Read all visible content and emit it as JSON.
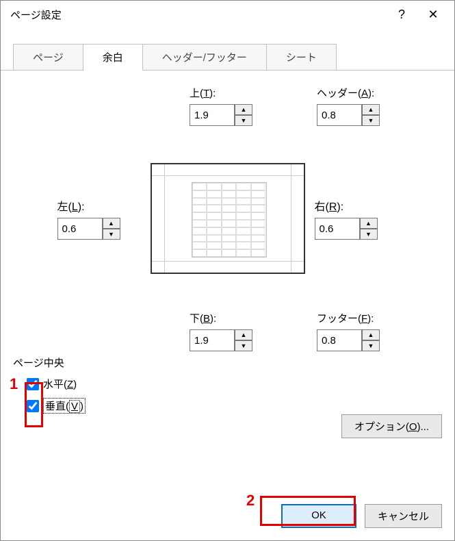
{
  "window": {
    "title": "ページ設定"
  },
  "tabs": {
    "page": "ページ",
    "margins": "余白",
    "header_footer": "ヘッダー/フッター",
    "sheet": "シート",
    "active": "margins"
  },
  "margins": {
    "top_label": "上(T):",
    "top_value": "1.9",
    "header_label": "ヘッダー(A):",
    "header_value": "0.8",
    "left_label": "左(L):",
    "left_value": "0.6",
    "right_label": "右(R):",
    "right_value": "0.6",
    "bottom_label": "下(B):",
    "bottom_value": "1.9",
    "footer_label": "フッター(F):",
    "footer_value": "0.8"
  },
  "center": {
    "legend": "ページ中央",
    "horizontal_label": "水平(Z)",
    "horizontal_checked": true,
    "vertical_label": "垂直(V)",
    "vertical_checked": true
  },
  "buttons": {
    "options": "オプション(O)...",
    "ok": "OK",
    "cancel": "キャンセル"
  },
  "titlebar": {
    "help": "?",
    "close": "✕"
  },
  "annotations": {
    "a1": "1",
    "a2": "2"
  }
}
